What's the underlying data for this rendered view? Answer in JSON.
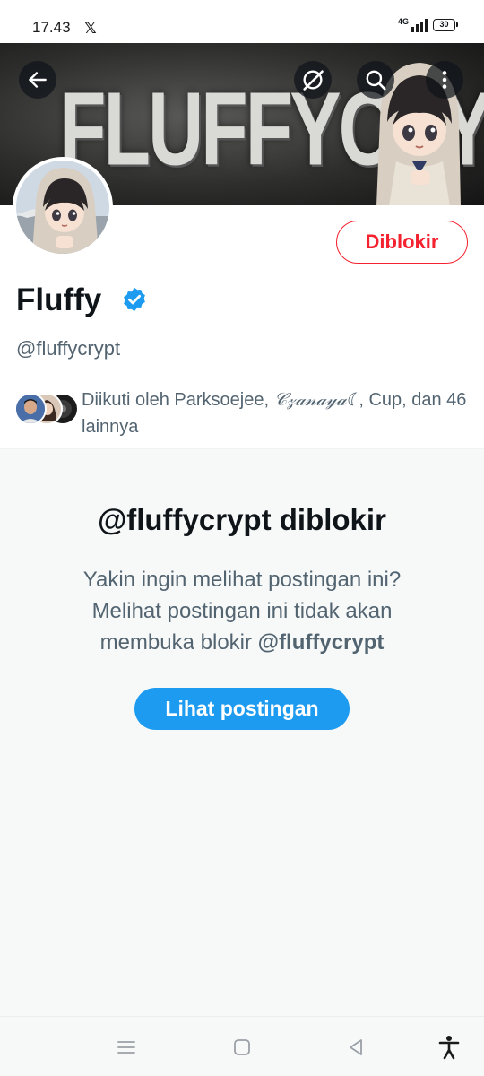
{
  "status_bar": {
    "time": "17.43",
    "notification_icon": "x-logo-icon",
    "network": "4G",
    "battery": "30"
  },
  "banner": {
    "text": "FLUFFYCRYPT",
    "icons": [
      "back-arrow-icon",
      "grok-icon",
      "search-icon",
      "more-vertical-icon"
    ]
  },
  "profile": {
    "display_name": "Fluffy",
    "verified": true,
    "handle": "@fluffycrypt",
    "blocked_button_label": "Diblokir",
    "followed_by": {
      "prefix": "Diikuti oleh Parksoejee, ",
      "fancy_name": "𝒞𝓏𝒶𝓃𝒶𝓎𝒶☾",
      "suffix": ", Cup, dan 46 lainnya"
    }
  },
  "blocked_notice": {
    "title": "@fluffycrypt diblokir",
    "description_line1": "Yakin ingin melihat postingan ini?",
    "description_line2": "Melihat postingan ini tidak akan",
    "description_line3_prefix": "membuka blokir ",
    "description_line3_handle": "@fluffycrypt",
    "button_label": "Lihat postingan"
  },
  "colors": {
    "accent_blue": "#1d9bf0",
    "blocked_red": "#f4212e",
    "secondary_text": "#536471",
    "section_bg": "#f7f9f9"
  },
  "nav_bar": {
    "icons": [
      "menu-icon",
      "home-square-icon",
      "back-triangle-icon",
      "accessibility-icon"
    ]
  }
}
